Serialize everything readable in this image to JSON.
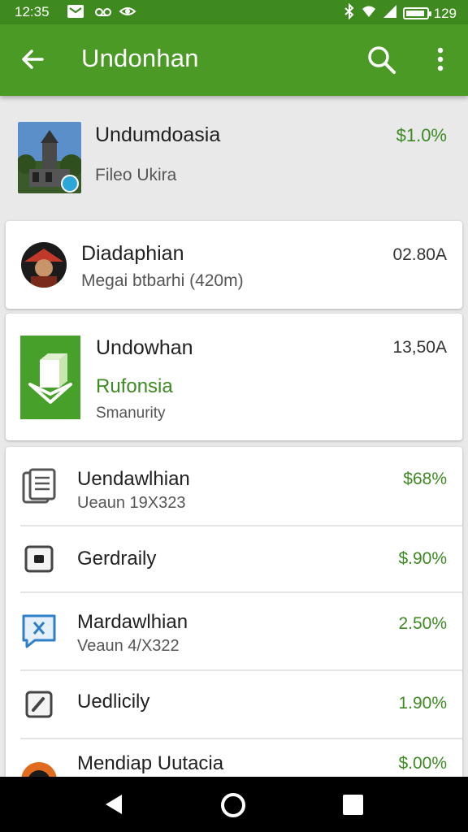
{
  "status_bar": {
    "time": "12:35",
    "signal_text": "129",
    "notification_icons": [
      "gmail-icon",
      "voicemail-icon",
      "eye-icon"
    ],
    "system_icons": [
      "bluetooth-icon",
      "wifi-icon",
      "signal-icon",
      "battery-icon"
    ],
    "battery_level": 0.92
  },
  "app_bar": {
    "title": "Undonhan",
    "icons": [
      "back-arrow-icon",
      "search-icon",
      "more-vert-icon"
    ]
  },
  "hero_item": {
    "name": "Undumdoasia",
    "subtitle": "Fileo Ukira",
    "price": "$1.0%"
  },
  "card_person": {
    "name": "Diadaphian",
    "subtitle": "Megai btbarhi (420m)",
    "amount": "02.80A"
  },
  "card_app": {
    "name": "Undowhan",
    "accent": "Rufonsia",
    "subtitle": "Smanurity",
    "amount": "13,50A"
  },
  "list": [
    {
      "name": "Uendawlhian",
      "subtitle": "Ueaun 19X323",
      "value": "$68%",
      "icon": "document-icon"
    },
    {
      "name": "Gerdraily",
      "subtitle": "",
      "value": "$.90%",
      "icon": "camera-icon"
    },
    {
      "name": "Mardawlhian",
      "subtitle": "Veaun 4/X322",
      "value": "2.50%",
      "icon": "chat-bubble-icon"
    },
    {
      "name": "Uedlicily",
      "subtitle": "",
      "value": "1.90%",
      "icon": "edit-icon"
    },
    {
      "name": "Mendiap Uutacia",
      "subtitle": "",
      "value": "$.00%",
      "icon": "avatar-icon"
    }
  ],
  "nav_bar": {
    "icons": [
      "nav-back-icon",
      "nav-home-icon",
      "nav-recents-icon"
    ]
  },
  "colors": {
    "app_bar": "#4b9a26",
    "status_bar": "#3f8a1e",
    "accent_text": "#3d8a22",
    "background": "#e9e9e9"
  }
}
